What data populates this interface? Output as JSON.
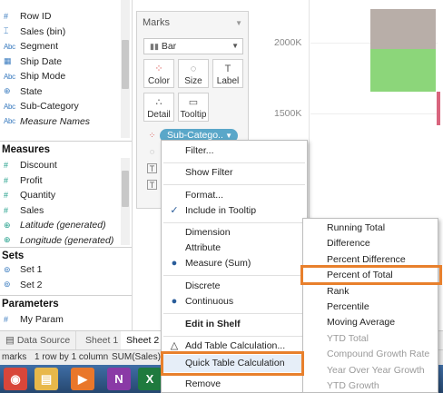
{
  "dimensions": [
    {
      "label": "Row ID",
      "icon": "#",
      "type": "num"
    },
    {
      "label": "Sales (bin)",
      "icon": "⌶",
      "type": "bin"
    },
    {
      "label": "Segment",
      "icon": "Abc",
      "type": "abc"
    },
    {
      "label": "Ship Date",
      "icon": "▦",
      "type": "date"
    },
    {
      "label": "Ship Mode",
      "icon": "Abc",
      "type": "abc"
    },
    {
      "label": "State",
      "icon": "⊕",
      "type": "geo"
    },
    {
      "label": "Sub-Category",
      "icon": "Abc",
      "type": "abc"
    },
    {
      "label": "Measure Names",
      "icon": "Abc",
      "type": "abc",
      "italic": true
    }
  ],
  "measures_heading": "Measures",
  "measures": [
    {
      "label": "Discount",
      "icon": "#"
    },
    {
      "label": "Profit",
      "icon": "#"
    },
    {
      "label": "Quantity",
      "icon": "#"
    },
    {
      "label": "Sales",
      "icon": "#"
    },
    {
      "label": "Latitude (generated)",
      "icon": "⊕",
      "italic": true
    },
    {
      "label": "Longitude (generated)",
      "icon": "⊕",
      "italic": true
    }
  ],
  "sets_heading": "Sets",
  "sets": [
    {
      "label": "Set 1"
    },
    {
      "label": "Set 2"
    }
  ],
  "parameters_heading": "Parameters",
  "parameters": [
    {
      "label": "My Param"
    }
  ],
  "marks": {
    "title": "Marks",
    "mark_type": "Bar",
    "buttons": {
      "color": "Color",
      "size": "Size",
      "label": "Label",
      "detail": "Detail",
      "tooltip": "Tooltip"
    },
    "pill": "Sub-Catego.."
  },
  "chart": {
    "ticks": [
      "2000K",
      "1500K"
    ],
    "bars": [
      {
        "color": "#b8aea8"
      },
      {
        "color": "#8cd67a"
      },
      {
        "color": "#d9657e"
      }
    ]
  },
  "tabs": {
    "data_source": "Data Source",
    "sheet1": "Sheet 1",
    "sheet2": "Sheet 2"
  },
  "status": {
    "marks": "marks",
    "rows": "1 row by 1 column",
    "sum": "SUM(Sales): 2"
  },
  "context_menu": {
    "filter": "Filter...",
    "show_filter": "Show Filter",
    "format": "Format...",
    "include_tooltip": "Include in Tooltip",
    "dimension": "Dimension",
    "attribute": "Attribute",
    "measure": "Measure (Sum)",
    "discrete": "Discrete",
    "continuous": "Continuous",
    "edit_shelf": "Edit in Shelf",
    "add_table_calc": "Add Table Calculation...",
    "quick_table_calc": "Quick Table Calculation",
    "remove": "Remove"
  },
  "submenu": [
    {
      "label": "Running Total",
      "enabled": true
    },
    {
      "label": "Difference",
      "enabled": true
    },
    {
      "label": "Percent Difference",
      "enabled": true
    },
    {
      "label": "Percent of Total",
      "enabled": true
    },
    {
      "label": "Rank",
      "enabled": true
    },
    {
      "label": "Percentile",
      "enabled": true
    },
    {
      "label": "Moving Average",
      "enabled": true
    },
    {
      "label": "YTD Total",
      "enabled": false
    },
    {
      "label": "Compound Growth Rate",
      "enabled": false
    },
    {
      "label": "Year Over Year Growth",
      "enabled": false
    },
    {
      "label": "YTD Growth",
      "enabled": false
    }
  ],
  "taskbar": [
    {
      "name": "chrome",
      "color": "#d8463a",
      "glyph": "◉"
    },
    {
      "name": "explorer",
      "color": "#e8b84a",
      "glyph": "▤"
    },
    {
      "name": "media",
      "color": "#e9772b",
      "glyph": "▶"
    },
    {
      "name": "onenote",
      "color": "#8a3aa6",
      "glyph": "N"
    },
    {
      "name": "excel",
      "color": "#1f7a3e",
      "glyph": "X"
    }
  ]
}
